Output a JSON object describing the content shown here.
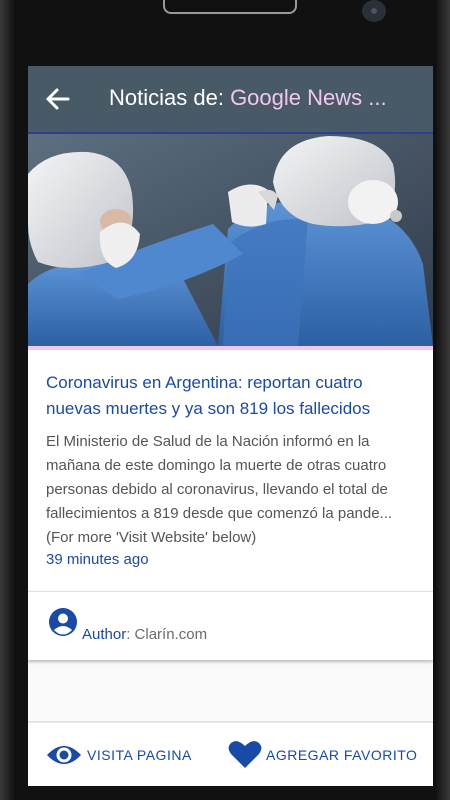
{
  "app_bar": {
    "title_prefix": "Noticias de: ",
    "title_source": "Google News ..."
  },
  "article": {
    "image_description": "coronavirus-workers-in-protective-suits",
    "headline": "Coronavirus en Argentina: reportan cuatro nuevas muertes y ya son 819 los fallecidos",
    "summary_lines": [
      "El Ministerio de Salud de la Nación informó en la",
      "mañana de este domingo la muerte de otras cuatro",
      "personas debido al coronavirus, llevando el total de",
      "fallecimientos a 819 desde que comenzó la pande...",
      "(For more 'Visit Website' below)"
    ],
    "time_ago": "39 minutes ago"
  },
  "author": {
    "label": "Author",
    "separator": ": ",
    "name": "Clarín.com"
  },
  "actions": {
    "visit_label": "VISITA PAGINA",
    "favorite_label": "AGREGAR FAVORITO"
  },
  "colors": {
    "app_bar": "#475a66",
    "accent_pink": "#f3c6f0",
    "link_blue": "#1a4aa8"
  }
}
